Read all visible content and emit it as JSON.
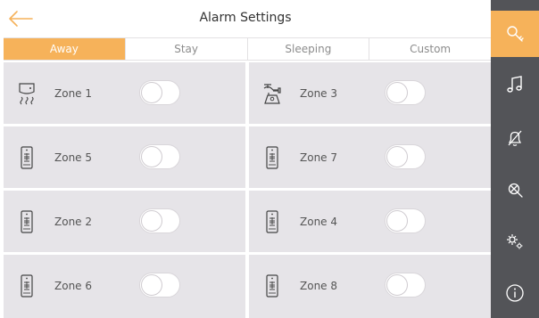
{
  "header": {
    "title": "Alarm Settings"
  },
  "tabs": [
    {
      "label": "Away",
      "active": true
    },
    {
      "label": "Stay",
      "active": false
    },
    {
      "label": "Sleeping",
      "active": false
    },
    {
      "label": "Custom",
      "active": false
    }
  ],
  "zones": [
    {
      "label": "Zone 1",
      "icon": "smoke-detector-icon",
      "enabled": false
    },
    {
      "label": "Zone 3",
      "icon": "gas-detector-icon",
      "enabled": false
    },
    {
      "label": "Zone 5",
      "icon": "door-sensor-icon",
      "enabled": false
    },
    {
      "label": "Zone 7",
      "icon": "door-sensor-icon",
      "enabled": false
    },
    {
      "label": "Zone 2",
      "icon": "door-sensor-icon",
      "enabled": false
    },
    {
      "label": "Zone 4",
      "icon": "door-sensor-icon",
      "enabled": false
    },
    {
      "label": "Zone 6",
      "icon": "door-sensor-icon",
      "enabled": false
    },
    {
      "label": "Zone 8",
      "icon": "door-sensor-icon",
      "enabled": false
    }
  ],
  "sidebar": [
    {
      "icon": "key-icon",
      "active": true
    },
    {
      "icon": "music-note-icon",
      "active": false
    },
    {
      "icon": "bell-off-icon",
      "active": false
    },
    {
      "icon": "wrench-icon",
      "active": false
    },
    {
      "icon": "gears-icon",
      "active": false
    },
    {
      "icon": "info-icon",
      "active": false
    }
  ],
  "colors": {
    "accent": "#f6b25a",
    "sidebar": "#535458",
    "cell": "#e6e4e8"
  }
}
